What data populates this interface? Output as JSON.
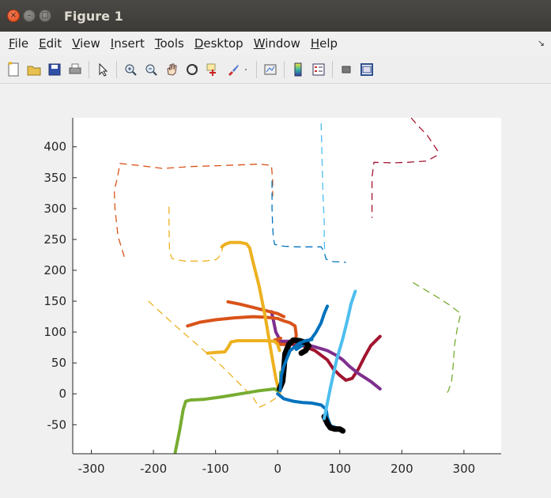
{
  "window": {
    "title": "Figure 1",
    "close_glyph": "×",
    "min_glyph": "–",
    "max_glyph": "□"
  },
  "menu": {
    "items": [
      {
        "label": "File",
        "ul": "F",
        "rest": "ile"
      },
      {
        "label": "Edit",
        "ul": "E",
        "rest": "dit"
      },
      {
        "label": "View",
        "ul": "V",
        "rest": "iew"
      },
      {
        "label": "Insert",
        "ul": "I",
        "rest": "nsert"
      },
      {
        "label": "Tools",
        "ul": "T",
        "rest": "ools"
      },
      {
        "label": "Desktop",
        "ul": "D",
        "rest": "esktop"
      },
      {
        "label": "Window",
        "ul": "W",
        "rest": "indow"
      },
      {
        "label": "Help",
        "ul": "H",
        "rest": "elp"
      }
    ],
    "dock_arrow": "↘"
  },
  "toolbar": {
    "icons": [
      "new-figure-icon",
      "open-file-icon",
      "save-icon",
      "print-icon",
      "sep",
      "pointer-icon",
      "sep",
      "zoom-in-icon",
      "zoom-out-icon",
      "pan-icon",
      "rotate-3d-icon",
      "data-cursor-icon",
      "brush-icon",
      "brush-dropdown-icon",
      "sep",
      "link-plot-icon",
      "sep",
      "colorbar-icon",
      "legend-icon",
      "sep",
      "hide-plot-tools-icon",
      "show-plot-tools-icon"
    ]
  },
  "colors": {
    "blue": "#0072bd",
    "orange": "#d95319",
    "yellow": "#edb120",
    "purple": "#7e2f8e",
    "green": "#77ac30",
    "cyan": "#4dbeee",
    "maroon": "#a2142f",
    "black": "#000000"
  },
  "chart_data": {
    "type": "line",
    "title": "",
    "xlabel": "",
    "ylabel": "",
    "xlim": [
      -330,
      360
    ],
    "ylim": [
      -97,
      447
    ],
    "xticks": [
      -300,
      -200,
      -100,
      0,
      100,
      200,
      300
    ],
    "yticks": [
      -50,
      0,
      50,
      100,
      150,
      200,
      250,
      300,
      350,
      400
    ],
    "grid": false,
    "legend": "none",
    "series": [
      {
        "color": "#d95319",
        "style": "dashed",
        "width": 1.3,
        "x": [
          -247,
          -257,
          -262,
          -263,
          -258,
          -254,
          -225,
          -185,
          -140,
          -80,
          -30,
          -10,
          -8,
          -8
        ],
        "y": [
          222,
          255,
          300,
          330,
          350,
          373,
          370,
          365,
          368,
          370,
          372,
          370,
          345,
          320
        ]
      },
      {
        "color": "#edb120",
        "style": "dashed",
        "width": 1.3,
        "x": [
          -175,
          -175,
          -174,
          -170,
          -150,
          -120,
          -100,
          -95,
          -90,
          -88
        ],
        "y": [
          303,
          270,
          230,
          219,
          215,
          215,
          217,
          221,
          230,
          240
        ]
      },
      {
        "color": "#0072bd",
        "style": "dashed",
        "width": 1.3,
        "x": [
          -9,
          -9,
          -8,
          -7,
          -5,
          10,
          30,
          50,
          70,
          75,
          78,
          90,
          110
        ],
        "y": [
          345,
          300,
          270,
          255,
          242,
          239,
          238,
          238,
          238,
          230,
          218,
          214,
          213
        ]
      },
      {
        "color": "#4dbeee",
        "style": "dashed",
        "width": 1.3,
        "x": [
          70,
          71,
          72,
          73,
          75,
          75,
          76
        ],
        "y": [
          438,
          400,
          360,
          320,
          280,
          250,
          225
        ]
      },
      {
        "color": "#a2142f",
        "style": "dashed",
        "width": 1.3,
        "x": [
          215,
          225,
          240,
          250,
          258,
          255,
          240,
          210,
          185,
          155,
          152,
          152
        ],
        "y": [
          447,
          435,
          420,
          405,
          393,
          385,
          377,
          375,
          374,
          375,
          350,
          285
        ]
      },
      {
        "color": "#77ac30",
        "style": "dashed",
        "width": 1.3,
        "x": [
          218,
          235,
          255,
          275,
          295,
          290,
          285,
          283,
          280,
          275,
          270
        ],
        "y": [
          180,
          170,
          158,
          145,
          130,
          110,
          80,
          50,
          20,
          5,
          -3
        ]
      },
      {
        "color": "#edb120",
        "style": "dashed",
        "width": 1.3,
        "x": [
          -208,
          -170,
          -130,
          -90,
          -60,
          -40,
          -30,
          -15,
          0
        ],
        "y": [
          150,
          115,
          80,
          45,
          15,
          -5,
          -22,
          -15,
          -5
        ]
      },
      {
        "color": "#a2142f",
        "style": "solid",
        "width": 4,
        "x": [
          5,
          10,
          40,
          60,
          80,
          90,
          100,
          110,
          120,
          130,
          140,
          150,
          165
        ],
        "y": [
          80,
          82,
          78,
          70,
          55,
          40,
          30,
          22,
          25,
          40,
          60,
          78,
          93
        ]
      },
      {
        "color": "#7e2f8e",
        "style": "solid",
        "width": 4,
        "x": [
          -10,
          -7,
          -3,
          5,
          25,
          45,
          60,
          80,
          95,
          105,
          115,
          130,
          150,
          165
        ],
        "y": [
          133,
          120,
          100,
          85,
          85,
          80,
          76,
          70,
          62,
          55,
          45,
          33,
          20,
          8
        ]
      },
      {
        "color": "#d95319",
        "style": "solid",
        "width": 4,
        "x": [
          -145,
          -125,
          -100,
          -70,
          -40,
          -20,
          0,
          10,
          20,
          28,
          30,
          28,
          20,
          5,
          -5,
          5
        ],
        "y": [
          110,
          116,
          120,
          123,
          125,
          124,
          122,
          118,
          115,
          110,
          95,
          85,
          80,
          80,
          87,
          90
        ]
      },
      {
        "color": "#d95319",
        "style": "solid",
        "width": 4,
        "x": [
          -80,
          -60,
          -40,
          -20,
          0,
          10
        ],
        "y": [
          149,
          145,
          140,
          135,
          130,
          125
        ]
      },
      {
        "color": "#edb120",
        "style": "solid",
        "width": 4,
        "x": [
          -113,
          -100,
          -85,
          -80,
          -75,
          -65,
          -40,
          -20,
          -5,
          0,
          3
        ],
        "y": [
          66,
          67,
          68,
          75,
          84,
          86,
          86,
          86,
          85,
          80,
          70
        ]
      },
      {
        "color": "#edb120",
        "style": "solid",
        "width": 4,
        "x": [
          -90,
          -85,
          -77,
          -60,
          -50,
          -45,
          -40,
          -30,
          -20,
          -10,
          -3,
          2,
          3
        ],
        "y": [
          238,
          242,
          245,
          245,
          243,
          236,
          215,
          175,
          125,
          65,
          25,
          5,
          0
        ]
      },
      {
        "color": "#77ac30",
        "style": "solid",
        "width": 4,
        "x": [
          -165,
          -158,
          -152,
          -148,
          -140,
          -120,
          -90,
          -60,
          -30,
          -5,
          0,
          3,
          5,
          5
        ],
        "y": [
          -95,
          -60,
          -25,
          -12,
          -10,
          -9,
          -5,
          0,
          5,
          8,
          5,
          8,
          15,
          35
        ]
      },
      {
        "color": "#0072bd",
        "style": "solid",
        "width": 4,
        "x": [
          0,
          10,
          25,
          40,
          55,
          70,
          78,
          80,
          85,
          95
        ],
        "y": [
          0,
          -8,
          -12,
          -14,
          -15,
          -18,
          -25,
          -38,
          -52,
          -55
        ]
      },
      {
        "color": "#0072bd",
        "style": "solid",
        "width": 4,
        "x": [
          30,
          45,
          55,
          62,
          70,
          75,
          80
        ],
        "y": [
          72,
          82,
          90,
          100,
          115,
          130,
          142
        ]
      },
      {
        "color": "#000000",
        "style": "solid",
        "width": 7,
        "x": [
          3,
          8,
          10,
          12,
          18,
          25,
          35,
          45,
          50,
          45,
          38
        ],
        "y": [
          8,
          20,
          40,
          65,
          80,
          87,
          86,
          83,
          78,
          70,
          66
        ]
      },
      {
        "color": "#000000",
        "style": "solid",
        "width": 7,
        "x": [
          75,
          80,
          85,
          92,
          100,
          105
        ],
        "y": [
          -37,
          -48,
          -55,
          -57,
          -57,
          -60
        ]
      },
      {
        "color": "#0072bd",
        "style": "solid",
        "width": 4,
        "x": [
          4,
          6,
          10,
          20,
          35,
          45,
          55
        ],
        "y": [
          5,
          30,
          45,
          70,
          82,
          86,
          88
        ]
      },
      {
        "color": "#4dbeee",
        "style": "solid",
        "width": 4,
        "x": [
          75,
          85,
          95,
          105,
          112,
          118,
          125
        ],
        "y": [
          -40,
          10,
          55,
          90,
          118,
          145,
          166
        ]
      }
    ]
  }
}
